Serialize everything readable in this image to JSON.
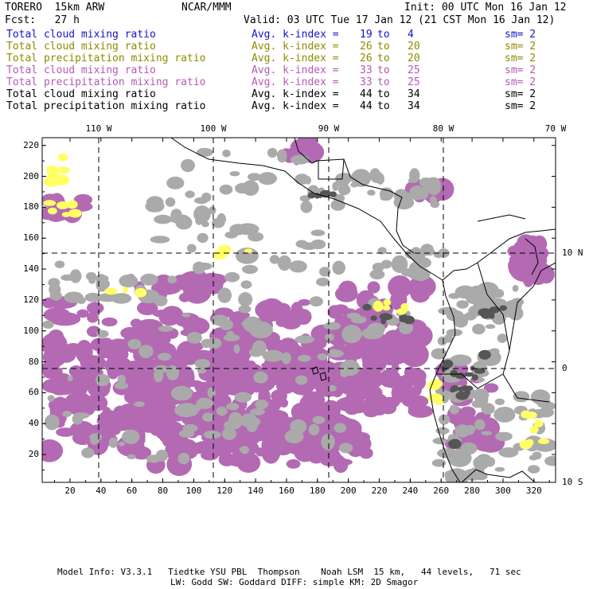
{
  "header": {
    "model": "TORERO  15km ARW",
    "org": "NCAR/MMM",
    "init": "Init: 00 UTC Mon 16 Jan 12",
    "fcst": "Fcst:   27 h",
    "valid": "Valid: 03 UTC Tue 17 Jan 12 (21 CST Mon 16 Jan 12)"
  },
  "fields": [
    {
      "name": "Total cloud mixing ratio",
      "index": "Avg. k-index =",
      "lo": "19",
      "to": "to",
      "hi": "4",
      "sm": "sm= 2",
      "color": "#1414c8"
    },
    {
      "name": "Total cloud mixing ratio",
      "index": "Avg. k-index =",
      "lo": "26",
      "to": "to",
      "hi": "20",
      "sm": "sm= 2",
      "color": "#8c8c00"
    },
    {
      "name": "Total precipitation mixing ratio",
      "index": "Avg. k-index =",
      "lo": "26",
      "to": "to",
      "hi": "20",
      "sm": "sm= 2",
      "color": "#8c8c00"
    },
    {
      "name": "Total cloud mixing ratio",
      "index": "Avg. k-index =",
      "lo": "33",
      "to": "to",
      "hi": "25",
      "sm": "sm= 2",
      "color": "#b45ab4"
    },
    {
      "name": "Total precipitation mixing ratio",
      "index": "Avg. k-index =",
      "lo": "33",
      "to": "to",
      "hi": "25",
      "sm": "sm= 2",
      "color": "#b45ab4"
    },
    {
      "name": "Total cloud mixing ratio",
      "index": "Avg. k-index =",
      "lo": "44",
      "to": "to",
      "hi": "34",
      "sm": "sm= 2",
      "color": "#000000"
    },
    {
      "name": "Total precipitation mixing ratio",
      "index": "Avg. k-index =",
      "lo": "44",
      "to": "to",
      "hi": "34",
      "sm": "sm= 2",
      "color": "#000000"
    }
  ],
  "map": {
    "lon_labels": [
      "110 W",
      "100 W",
      "90 W",
      "80 W",
      "70 W"
    ],
    "lat_labels": [
      "10 N",
      "0",
      "10 S"
    ],
    "y_ticks": [
      "220",
      "200",
      "180",
      "160",
      "140",
      "120",
      "100",
      "80",
      "60",
      "40",
      "20"
    ],
    "x_ticks": [
      "20",
      "40",
      "60",
      "80",
      "100",
      "120",
      "140",
      "160",
      "180",
      "200",
      "220",
      "240",
      "260",
      "280",
      "300",
      "320"
    ],
    "colors": {
      "purple": "#b36ab3",
      "gray": "#aaaaaa",
      "dark": "#555555",
      "yellow": "#ffff66",
      "cyan": "#d8f4ff"
    }
  },
  "footer": {
    "line1": "Model Info: V3.3.1   Tiedtke YSU PBL  Thompson    Noah LSM  15 km,   44 levels,   71 sec",
    "line2": "LW: Godd SW: Goddard DIFF: simple KM: 2D Smagor"
  }
}
